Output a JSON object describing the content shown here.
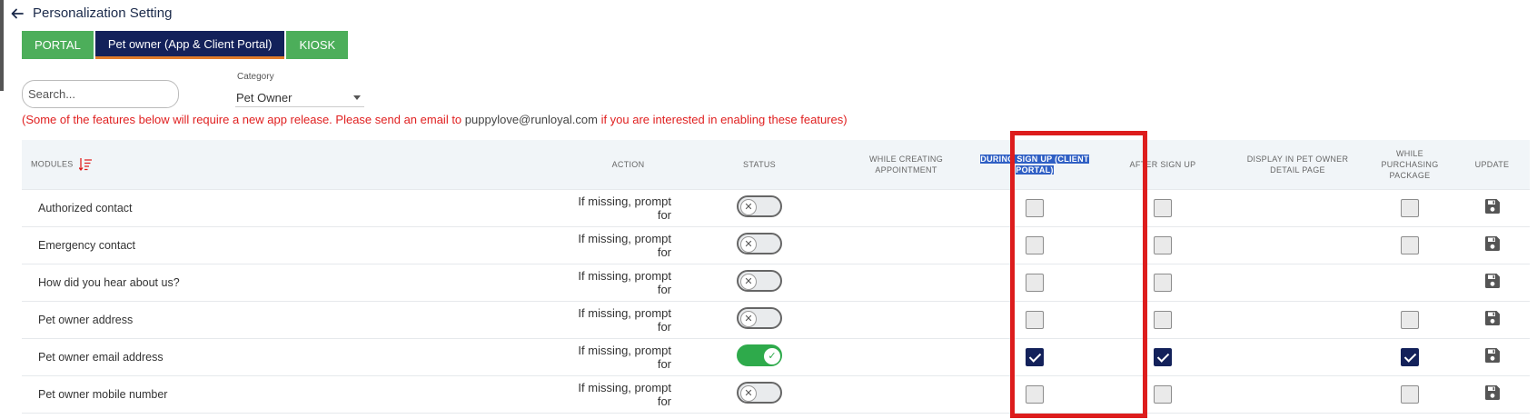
{
  "header": {
    "title": "Personalization Setting"
  },
  "tabs": [
    {
      "label": "PORTAL",
      "active": false
    },
    {
      "label": "Pet owner (App & Client Portal)",
      "active": true
    },
    {
      "label": "KIOSK",
      "active": false
    }
  ],
  "search": {
    "placeholder": "Search...",
    "value": ""
  },
  "category": {
    "label": "Category",
    "value": "Pet Owner"
  },
  "notice": {
    "before": "(Some of the features below will require a new app release. Please send an email to ",
    "email": "puppylove@runloyal.com",
    "after": " if you are interested in enabling these features)"
  },
  "columns": {
    "modules": "MODULES",
    "action": "ACTION",
    "status": "STATUS",
    "while_creating": "WHILE CREATING APPOINTMENT",
    "during_signup": "DURING SIGN UP (CLIENT PORTAL)",
    "after_signup": "AFTER SIGN UP",
    "display_detail": "DISPLAY IN PET OWNER DETAIL PAGE",
    "while_purchasing": "WHILE PURCHASING PACKAGE",
    "update": "UPDATE"
  },
  "rows": [
    {
      "module": "Authorized contact",
      "action": "If missing, prompt for",
      "status_on": false,
      "during_signup": false,
      "after_signup": false,
      "while_purchasing": false,
      "has_purchasing": true
    },
    {
      "module": "Emergency contact",
      "action": "If missing, prompt for",
      "status_on": false,
      "during_signup": false,
      "after_signup": false,
      "while_purchasing": false,
      "has_purchasing": true
    },
    {
      "module": "How did you hear about us?",
      "action": "If missing, prompt for",
      "status_on": false,
      "during_signup": false,
      "after_signup": false,
      "while_purchasing": false,
      "has_purchasing": false
    },
    {
      "module": "Pet owner address",
      "action": "If missing, prompt for",
      "status_on": false,
      "during_signup": false,
      "after_signup": false,
      "while_purchasing": false,
      "has_purchasing": true
    },
    {
      "module": "Pet owner email address",
      "action": "If missing, prompt for",
      "status_on": true,
      "during_signup": true,
      "after_signup": true,
      "while_purchasing": true,
      "has_purchasing": true
    },
    {
      "module": "Pet owner mobile number",
      "action": "If missing, prompt for",
      "status_on": false,
      "during_signup": false,
      "after_signup": false,
      "while_purchasing": false,
      "has_purchasing": true
    }
  ],
  "icons": {
    "back": "arrow-left-icon",
    "sort": "sort-descending-icon",
    "toggle_off": "x-icon",
    "toggle_on": "check-icon",
    "save": "floppy-disk-icon"
  },
  "colors": {
    "tab_green": "#4cae5a",
    "tab_active": "#13215a",
    "tab_underline": "#e07b2a",
    "notice_red": "#e02020",
    "toggle_on": "#2eaa4b",
    "checkbox_checked": "#13215a",
    "highlight_box": "#dd1d1d",
    "selected_text_bg": "#2f5fc4"
  }
}
